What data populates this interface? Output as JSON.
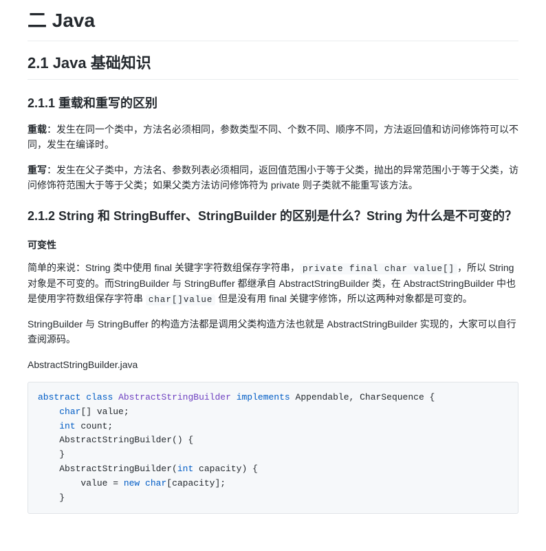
{
  "h1": "二 Java",
  "h2": "2.1 Java 基础知识",
  "s211": {
    "title": "2.1.1 重载和重写的区别",
    "p1_label": "重载",
    "p1_text": "：发生在同一个类中，方法名必须相同，参数类型不同、个数不同、顺序不同，方法返回值和访问修饰符可以不同，发生在编译时。",
    "p2_label": "重写",
    "p2_text": "：发生在父子类中，方法名、参数列表必须相同，返回值范围小于等于父类，抛出的异常范围小于等于父类，访问修饰符范围大于等于父类；如果父类方法访问修饰符为 private 则子类就不能重写该方法。"
  },
  "s212": {
    "title": "2.1.2 String 和 StringBuffer、StringBuilder 的区别是什么？String 为什么是不可变的？",
    "sub1": "可变性",
    "p1_a": "简单的来说：String 类中使用 final 关键字字符数组保存字符串，",
    "p1_code1": "private final char value[]",
    "p1_b": "，所以 String 对象是不可变的。而StringBuilder 与 StringBuffer 都继承自 AbstractStringBuilder 类，在 AbstractStringBuilder 中也是使用字符数组保存字符串 ",
    "p1_code2": "char[]value",
    "p1_c": " 但是没有用 final 关键字修饰，所以这两种对象都是可变的。",
    "p2": "StringBuilder 与 StringBuffer 的构造方法都是调用父类构造方法也就是 AbstractStringBuilder 实现的，大家可以自行查阅源码。",
    "p3": "AbstractStringBuilder.java"
  },
  "code": {
    "kw_abstract": "abstract",
    "kw_class": "class",
    "cls_name": "AbstractStringBuilder",
    "kw_implements": "implements",
    "ifaces": " Appendable, CharSequence {",
    "line2a": "    ",
    "kw_char": "char",
    "line2b": "[] value;",
    "line3a": "    ",
    "kw_int": "int",
    "line3b": " count;",
    "line4": "    AbstractStringBuilder() {",
    "line5": "    }",
    "line6a": "    AbstractStringBuilder(",
    "kw_int2": "int",
    "line6b": " capacity) {",
    "line7a": "        value = ",
    "kw_new": "new",
    "line7b": " ",
    "kw_char2": "char",
    "line7c": "[capacity];",
    "line8": "    }"
  }
}
